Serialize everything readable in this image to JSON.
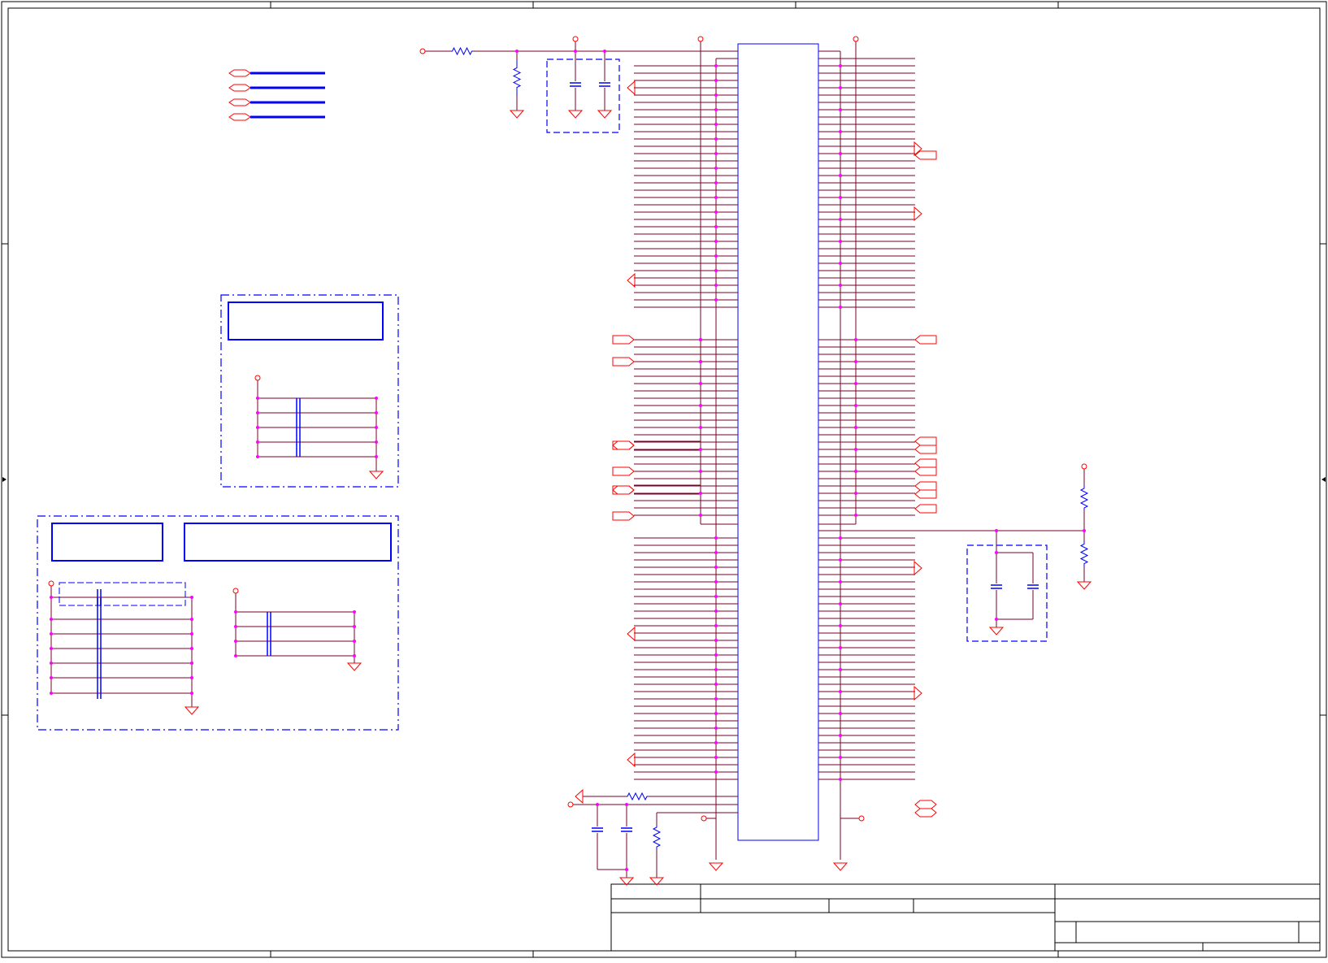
{
  "document": {
    "type": "schematic-sheet",
    "text_labels": [],
    "colors": {
      "frame": "#000000",
      "wire": "#7a0028",
      "component": "#0000ff",
      "port": "#ff0000",
      "junction": "#ff00ff",
      "group_box": "#0000ff",
      "background": "#ffffff"
    }
  },
  "title_block": {
    "fields": []
  }
}
